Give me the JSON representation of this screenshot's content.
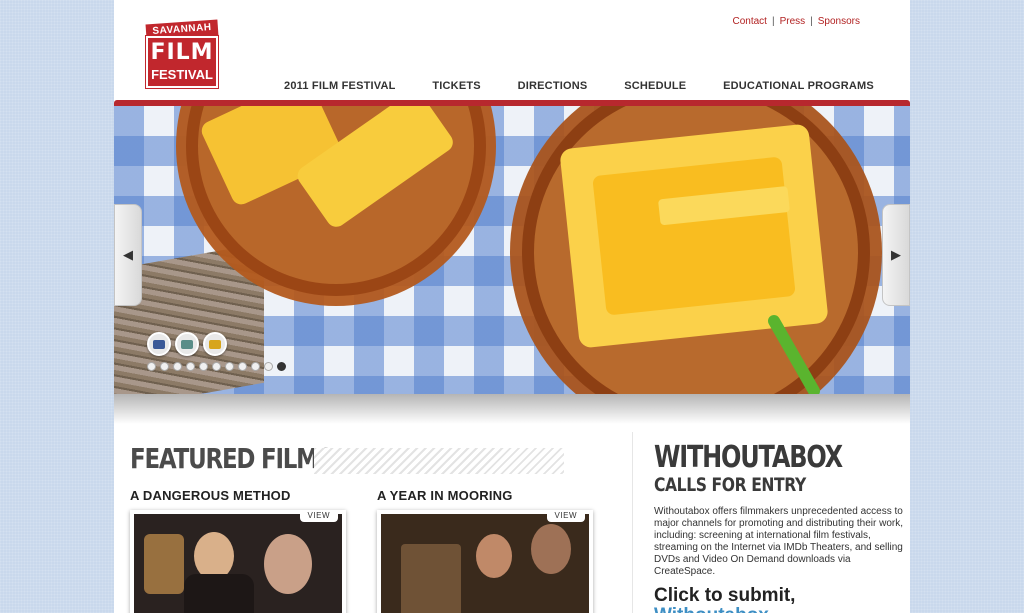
{
  "logo": {
    "top": "SAVANNAH",
    "main": "FILM",
    "bottom": "FESTIVAL"
  },
  "toplinks": [
    "Contact",
    "Press",
    "Sponsors"
  ],
  "nav": [
    "2011 FILM FESTIVAL",
    "TICKETS",
    "DIRECTIONS",
    "SCHEDULE",
    "EDUCATIONAL PROGRAMS"
  ],
  "slider": {
    "prev": "◀",
    "next": "▶",
    "thumbnails": [
      "#3b5a98",
      "#5a8d88",
      "#d7a51c"
    ],
    "dot_count": 11,
    "active_dot": 11
  },
  "featured": {
    "title": "FEATURED FILMS",
    "films": [
      {
        "title": "A DANGEROUS METHOD",
        "view": "VIEW"
      },
      {
        "title": "A YEAR IN MOORING",
        "view": "VIEW"
      }
    ]
  },
  "withoutabox": {
    "title": "WITHOUTABOX",
    "subtitle": "CALLS FOR ENTRY",
    "body": "Withoutabox offers filmmakers unprecedented access to major channels for promoting and distributing their work, including: screening at international film festivals, streaming on the Internet via IMDb Theaters, and selling DVDs and Video On Demand downloads via CreateSpace.",
    "cta": "Click to submit,",
    "cta_link": "Withoutabox"
  },
  "colors": {
    "brand_red": "#c1272d",
    "link_red": "#b22222",
    "accent_blue": "#3e8fc4",
    "background": "#c9d8ec"
  }
}
